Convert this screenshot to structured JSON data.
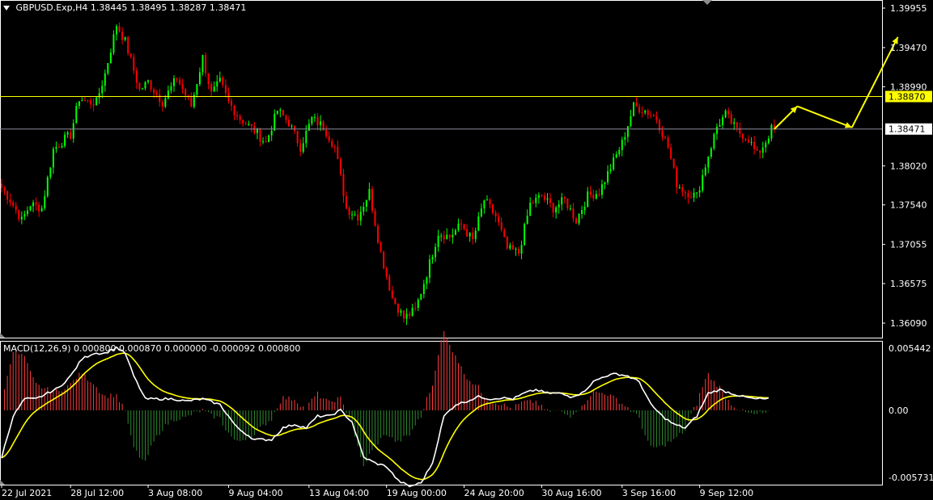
{
  "header": {
    "symbol": "GBPUSD.Exp,H4",
    "open": "1.38445",
    "high": "1.38495",
    "low": "1.38287",
    "close": "1.38471"
  },
  "macd_label": "MACD(12,26,9) 0.000800 0.000870 0.000000 -0.000092 0.000800",
  "colors": {
    "background": "#000000",
    "bull": "#00ff00",
    "bear": "#ff0000",
    "macd_line": "#ffffff",
    "signal_line": "#ffff00",
    "hist_up": "#ff3c3c",
    "hist_down": "#2e8b2e",
    "level_line": "#ffff00",
    "price_line": "#8c8ca0",
    "arrow": "#ffff00",
    "grid": "#ffffff"
  },
  "price_axis_ticks": [
    "1.39955",
    "1.39470",
    "1.38990",
    "1.38020",
    "1.37540",
    "1.37055",
    "1.36575",
    "1.36090"
  ],
  "level_label": "1.38870",
  "current_label": "1.38471",
  "macd_axis_ticks": [
    "0.005442",
    "0.00",
    "-0.005731"
  ],
  "time_ticks": [
    "22 Jul 2021",
    "28 Jul 12:00",
    "3 Aug 08:00",
    "9 Aug 04:00",
    "13 Aug 04:00",
    "19 Aug 00:00",
    "24 Aug 20:00",
    "30 Aug 16:00",
    "3 Sep 16:00",
    "9 Sep 12:00"
  ],
  "chart_data": {
    "type": "candlestick",
    "title": "GBPUSD.Exp,H4",
    "price_range": [
      1.3601,
      1.4005
    ],
    "macd_range": [
      -0.0066,
      0.0062
    ],
    "level": 1.3887,
    "current": 1.38471,
    "arrow_path": [
      [
        1.38471,
        0
      ],
      [
        1.3875,
        8
      ],
      [
        1.3849,
        27
      ],
      [
        1.396,
        43
      ]
    ],
    "price_anchors": [
      [
        0,
        1.3775
      ],
      [
        3,
        1.376
      ],
      [
        7,
        1.3735
      ],
      [
        10,
        1.3755
      ],
      [
        14,
        1.375
      ],
      [
        18,
        1.3822
      ],
      [
        22,
        1.3835
      ],
      [
        24,
        1.384
      ],
      [
        27,
        1.3885
      ],
      [
        30,
        1.388
      ],
      [
        33,
        1.388
      ],
      [
        36,
        1.3915
      ],
      [
        40,
        1.3975
      ],
      [
        43,
        1.3955
      ],
      [
        48,
        1.3895
      ],
      [
        51,
        1.3905
      ],
      [
        56,
        1.388
      ],
      [
        61,
        1.391
      ],
      [
        66,
        1.3875
      ],
      [
        70,
        1.3935
      ],
      [
        73,
        1.389
      ],
      [
        76,
        1.3905
      ],
      [
        79,
        1.388
      ],
      [
        83,
        1.386
      ],
      [
        88,
        1.3845
      ],
      [
        92,
        1.383
      ],
      [
        96,
        1.387
      ],
      [
        100,
        1.3855
      ],
      [
        104,
        1.3825
      ],
      [
        108,
        1.386
      ],
      [
        112,
        1.385
      ],
      [
        116,
        1.3825
      ],
      [
        120,
        1.375
      ],
      [
        124,
        1.374
      ],
      [
        128,
        1.377
      ],
      [
        132,
        1.3695
      ],
      [
        136,
        1.364
      ],
      [
        140,
        1.3615
      ],
      [
        144,
        1.3625
      ],
      [
        148,
        1.367
      ],
      [
        152,
        1.372
      ],
      [
        156,
        1.3715
      ],
      [
        160,
        1.373
      ],
      [
        164,
        1.371
      ],
      [
        168,
        1.376
      ],
      [
        172,
        1.374
      ],
      [
        176,
        1.37
      ],
      [
        180,
        1.3695
      ],
      [
        184,
        1.3755
      ],
      [
        188,
        1.3765
      ],
      [
        192,
        1.375
      ],
      [
        196,
        1.376
      ],
      [
        200,
        1.3735
      ],
      [
        204,
        1.3765
      ],
      [
        208,
        1.377
      ],
      [
        212,
        1.38
      ],
      [
        216,
        1.383
      ],
      [
        220,
        1.3875
      ],
      [
        224,
        1.387
      ],
      [
        228,
        1.386
      ],
      [
        232,
        1.3825
      ],
      [
        235,
        1.378
      ],
      [
        238,
        1.377
      ],
      [
        242,
        1.3765
      ],
      [
        246,
        1.3815
      ],
      [
        249,
        1.385
      ],
      [
        252,
        1.3865
      ],
      [
        256,
        1.3845
      ],
      [
        260,
        1.3835
      ],
      [
        263,
        1.3815
      ],
      [
        266,
        1.3832
      ],
      [
        268,
        1.3847
      ]
    ],
    "macd_anchors": [
      [
        0,
        -0.004
      ],
      [
        4,
        -0.0005
      ],
      [
        8,
        0.001
      ],
      [
        12,
        0.001
      ],
      [
        16,
        0.0015
      ],
      [
        20,
        0.002
      ],
      [
        24,
        0.003
      ],
      [
        28,
        0.0045
      ],
      [
        32,
        0.005
      ],
      [
        36,
        0.005
      ],
      [
        40,
        0.0055
      ],
      [
        43,
        0.005
      ],
      [
        46,
        0.003
      ],
      [
        50,
        0.001
      ],
      [
        55,
        0.001
      ],
      [
        60,
        0.001
      ],
      [
        64,
        0.0008
      ],
      [
        70,
        0.001
      ],
      [
        76,
        0.0005
      ],
      [
        82,
        -0.0015
      ],
      [
        88,
        -0.0025
      ],
      [
        94,
        -0.0025
      ],
      [
        98,
        -0.0015
      ],
      [
        102,
        -0.0012
      ],
      [
        106,
        -0.0015
      ],
      [
        110,
        -0.0005
      ],
      [
        114,
        -0.0005
      ],
      [
        118,
        -0.0
      ],
      [
        122,
        -0.001
      ],
      [
        126,
        -0.004
      ],
      [
        130,
        -0.0045
      ],
      [
        134,
        -0.0048
      ],
      [
        138,
        -0.006
      ],
      [
        142,
        -0.0065
      ],
      [
        146,
        -0.0062
      ],
      [
        150,
        -0.0045
      ],
      [
        154,
        -0.0005
      ],
      [
        158,
        0.0005
      ],
      [
        162,
        0.0008
      ],
      [
        166,
        0.0012
      ],
      [
        170,
        0.001
      ],
      [
        174,
        0.0011
      ],
      [
        178,
        0.001
      ],
      [
        182,
        0.0015
      ],
      [
        186,
        0.0018
      ],
      [
        190,
        0.0015
      ],
      [
        194,
        0.0015
      ],
      [
        198,
        0.0012
      ],
      [
        202,
        0.0015
      ],
      [
        206,
        0.0025
      ],
      [
        210,
        0.003
      ],
      [
        214,
        0.0032
      ],
      [
        218,
        0.003
      ],
      [
        222,
        0.0025
      ],
      [
        226,
        0.0005
      ],
      [
        230,
        -0.0005
      ],
      [
        234,
        -0.0012
      ],
      [
        238,
        -0.0015
      ],
      [
        242,
        -0.0005
      ],
      [
        246,
        0.0015
      ],
      [
        250,
        0.0018
      ],
      [
        254,
        0.0015
      ],
      [
        258,
        0.0012
      ],
      [
        262,
        0.001
      ],
      [
        266,
        0.001
      ]
    ]
  }
}
